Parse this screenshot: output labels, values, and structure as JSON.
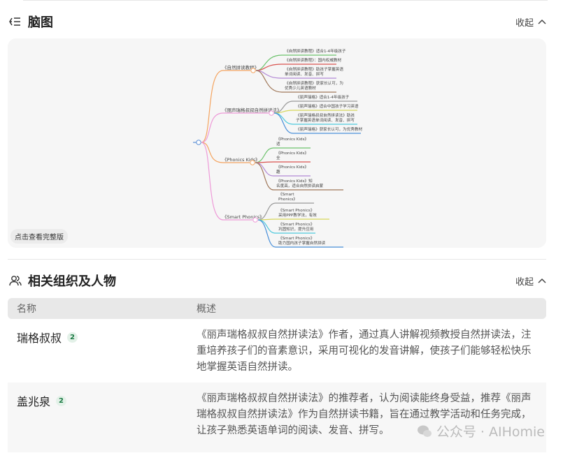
{
  "mindmap_section": {
    "title": "脑图",
    "collapse_label": "收起",
    "full_view_button": "点击查看完整版"
  },
  "mindmap": {
    "branches": [
      {
        "label": "《自然拼读教程》",
        "color": "#f4a460",
        "leaves": [
          {
            "lines": [
              "《自然拼读教程》适合1-4年级孩子"
            ],
            "color": "#6cc26c"
          },
          {
            "lines": [
              "《自然拼读教程》：国内权威教材"
            ],
            "color": "#d9534f"
          },
          {
            "lines": [
              "《自然拼读教程》助孩子掌握英语",
              "单词阅读、发音、拼写"
            ],
            "color": "#b48ad6"
          },
          {
            "lines": [
              "《自然拼读教程》获家长认可，为",
              "优秀少儿英语教材"
            ],
            "color": "#a0785a"
          }
        ]
      },
      {
        "label": "《丽声瑞格叔叔自然拼读法》",
        "color": "#ee9ad8",
        "leaves": [
          {
            "lines": [
              "《丽声瑞格》适合1-4年级孩子"
            ],
            "color": "#999999"
          },
          {
            "lines": [
              "《丽声瑞格》适合中国孩子学习英语"
            ],
            "color": "#d6d65a"
          },
          {
            "lines": [
              "《丽声瑞格叔叔自然拼读法》助孩",
              "子掌握英语单词阅读、发音、拼写"
            ],
            "color": "#4cc9dd"
          },
          {
            "lines": [
              "《丽声瑞格》获家长认可，为优秀教材"
            ],
            "color": "#4a90d9"
          }
        ]
      },
      {
        "label": "《Phonics Kids》",
        "color": "#f4a460",
        "leaves": [
          {
            "lines": [
              "《Phonics Kids》",
              "适"
            ],
            "color": "#6cc26c"
          },
          {
            "lines": [
              "《Phonics Kids》",
              "全"
            ],
            "color": "#d9534f"
          },
          {
            "lines": [
              "《Phonics Kids》",
              "趣"
            ],
            "color": "#b48ad6"
          },
          {
            "lines": [
              "《Phonics Kids》知",
              "名度高，适合自然拼读启蒙"
            ],
            "color": "#a0785a"
          }
        ]
      },
      {
        "label": "《Smart Phonics》",
        "color": "#ee9ad8",
        "leaves": [
          {
            "lines": [
              "《Smart",
              "Phonics》"
            ],
            "color": "#999999"
          },
          {
            "lines": [
              "《Smart Phonics》",
              "采用PPP教学法，有效"
            ],
            "color": "#d6d65a"
          },
          {
            "lines": [
              "《Smart Phonics》",
              "巩固知识，提升应用"
            ],
            "color": "#4cc9dd"
          },
          {
            "lines": [
              "《Smart Phonics》",
              "助力国内孩子掌握自然拼读"
            ],
            "color": "#4a90d9"
          }
        ]
      }
    ]
  },
  "related_section": {
    "title": "相关组织及人物",
    "collapse_label": "收起"
  },
  "table": {
    "headers": [
      "名称",
      "概述"
    ],
    "rows": [
      {
        "name": "瑞格叔叔",
        "count": "2",
        "desc": "《丽声瑞格叔叔自然拼读法》作者，通过真人讲解视频教授自然拼读法，注重培养孩子们的音素意识，采用可视化的发音讲解，使孩子们能够轻松快乐地掌握英语自然拼读。"
      },
      {
        "name": "盖兆泉",
        "count": "2",
        "desc": "《丽声瑞格叔叔自然拼读法》的推荐者，认为阅读能终身受益，推荐《丽声瑞格叔叔自然拼读法》作为自然拼读书籍，旨在通过教学活动和任务完成，让孩子熟悉英语单词的阅读、发音、拼写。"
      }
    ]
  },
  "watermark": "公众号 · AIHomie"
}
